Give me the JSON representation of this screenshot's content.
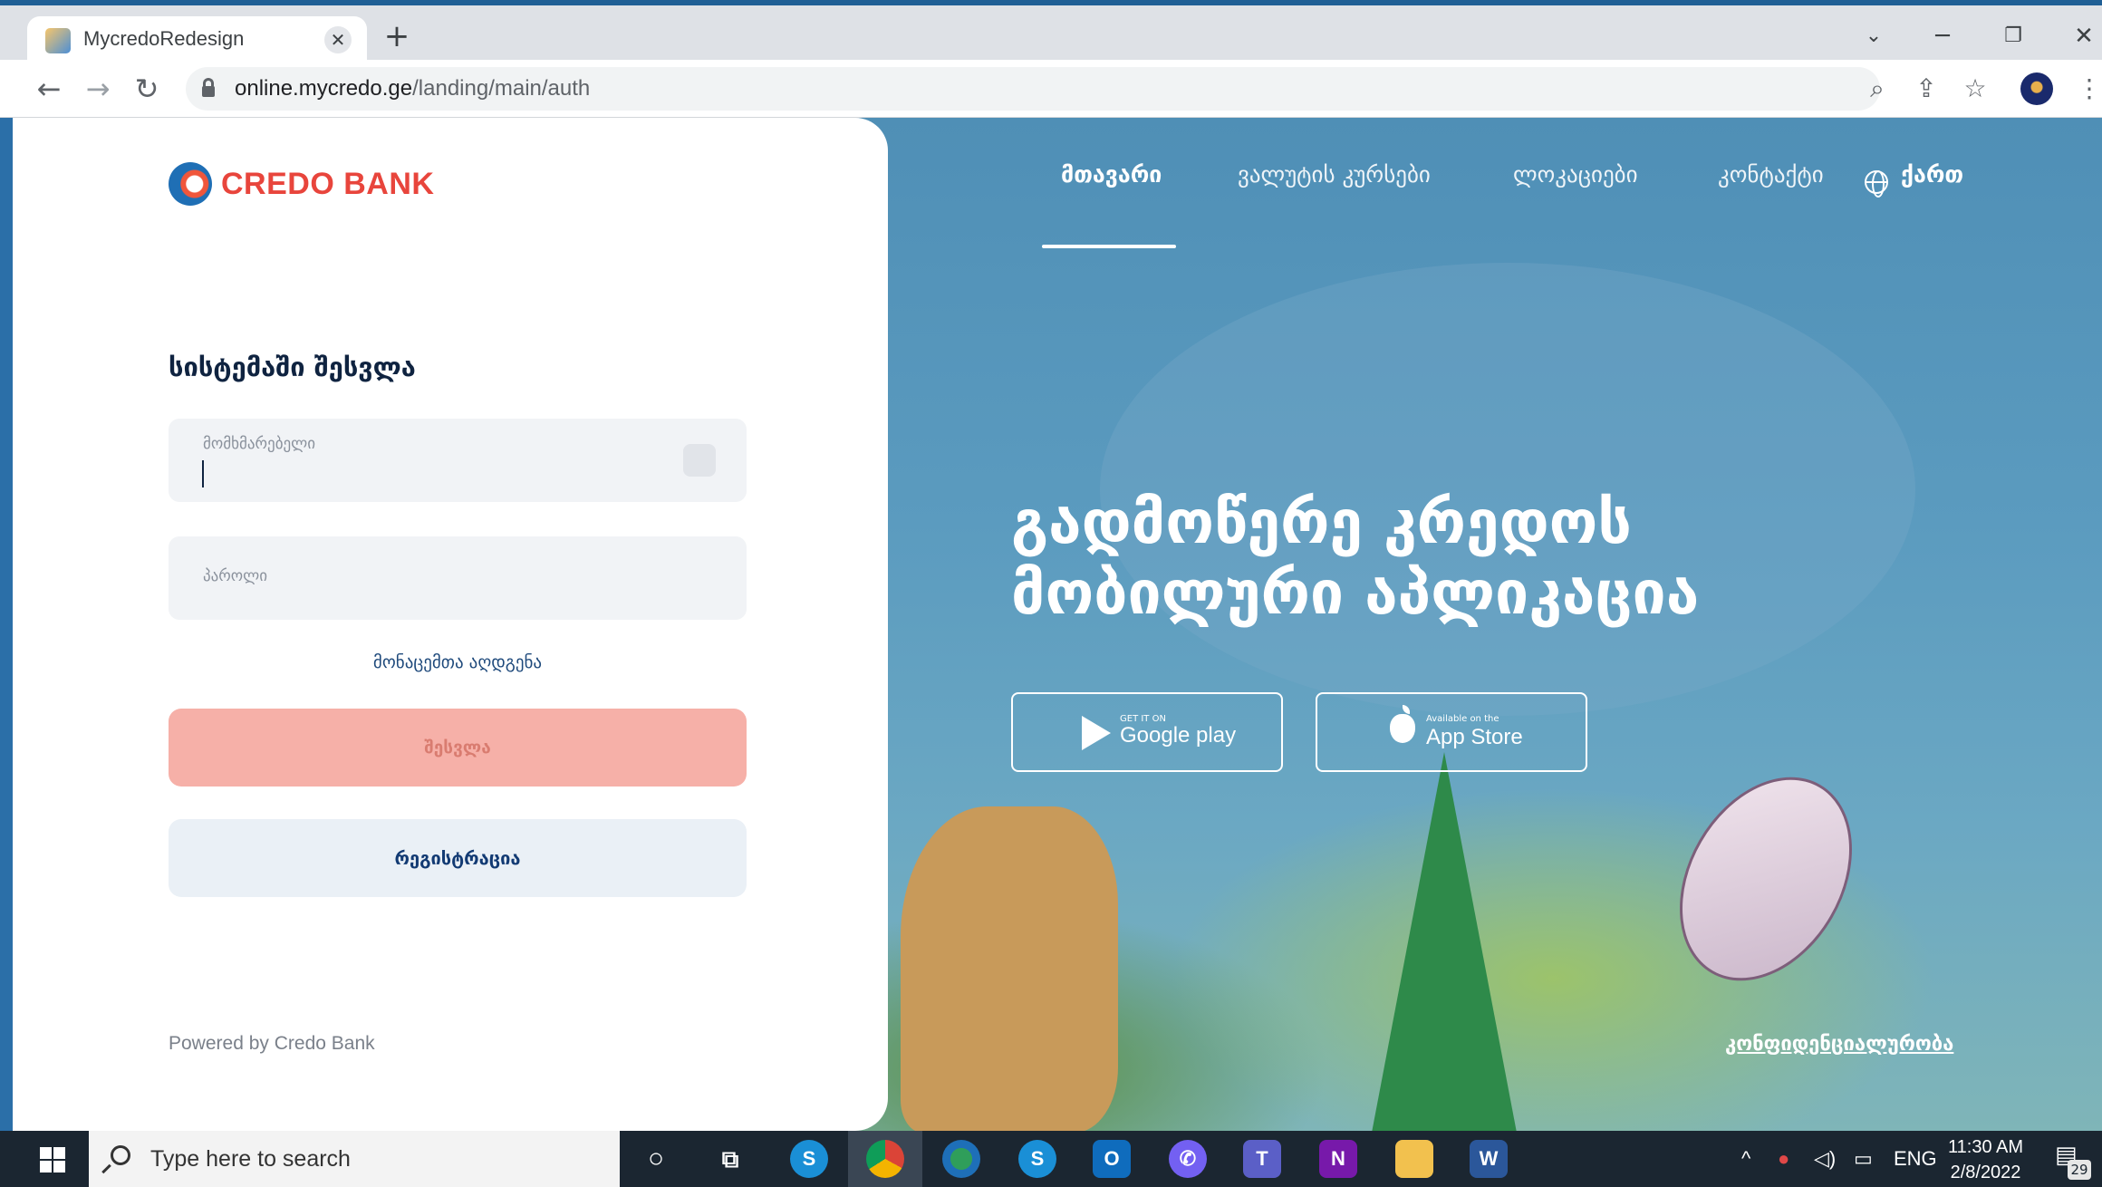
{
  "browser": {
    "tab_title": "MycredoRedesign",
    "tab_close": "✕",
    "new_tab": "+",
    "url_domain": "online.mycredo.ge",
    "url_path": "/landing/main/auth"
  },
  "login": {
    "brand": "CREDO BANK",
    "title": "სისტემაში შესვლა",
    "username_placeholder": "მომხმარებელი",
    "password_placeholder": "პაროლი",
    "forgot_link": "მონაცემთა აღდგენა",
    "login_button": "შესვლა",
    "register_button": "რეგისტრაცია",
    "powered_by": "Powered by Credo Bank"
  },
  "nav": {
    "items": [
      "მთავარი",
      "ვალუტის კურსები",
      "ლოკაციები",
      "კონტაქტი"
    ],
    "language": "ქართ"
  },
  "hero": {
    "title_line1": "გადმოწერე კრედოს",
    "title_line2": "მობილური აპლიკაცია",
    "google_small": "GET IT ON",
    "google_big": "Google play",
    "apple_small": "Available on the",
    "apple_big": "App Store",
    "privacy_link": "კონფიდენციალურობა"
  },
  "taskbar": {
    "search_placeholder": "Type here to search",
    "language": "ENG",
    "time": "11:30 AM",
    "date": "2/8/2022",
    "notification_count": "29"
  },
  "colors": {
    "brand_red": "#e8453c",
    "login_button": "#f6b0a8",
    "register_button": "#eaf0f6",
    "hero_sky": "#5b9bbf"
  }
}
